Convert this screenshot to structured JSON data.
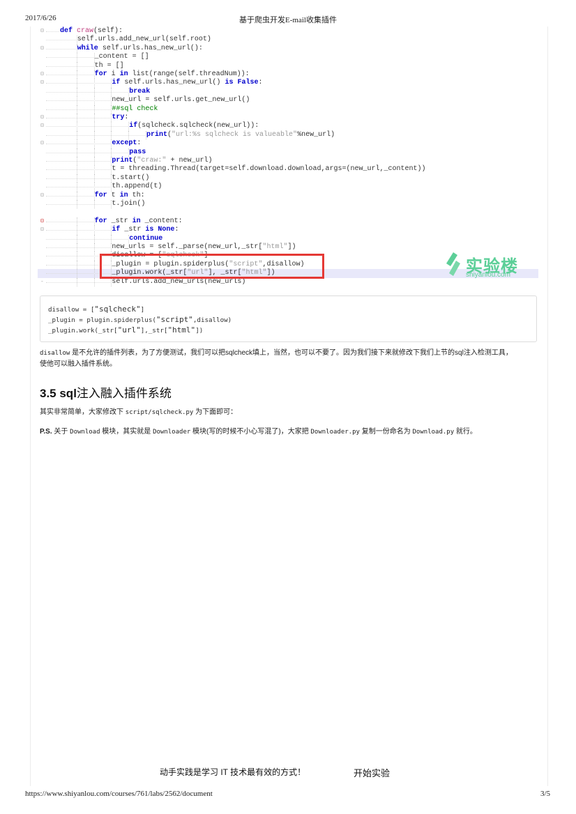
{
  "print_header": {
    "date": "2017/6/26",
    "title": "基于爬虫开发E-mail收集插件"
  },
  "code_screenshot": {
    "lines": [
      {
        "indent": 1,
        "gutter": "fold",
        "parts": [
          [
            "kw",
            "def "
          ],
          [
            "fn",
            "craw"
          ],
          [
            "",
            "(self):"
          ]
        ]
      },
      {
        "indent": 2,
        "gutter": "",
        "parts": [
          [
            "",
            "self.urls.add_new_url(self.root)"
          ]
        ]
      },
      {
        "indent": 2,
        "gutter": "fold",
        "parts": [
          [
            "kw",
            "while "
          ],
          [
            "",
            "self.urls.has_new_url():"
          ]
        ]
      },
      {
        "indent": 3,
        "gutter": "",
        "parts": [
          [
            "",
            "_content = []"
          ]
        ]
      },
      {
        "indent": 3,
        "gutter": "",
        "parts": [
          [
            "",
            "th = []"
          ]
        ]
      },
      {
        "indent": 3,
        "gutter": "fold",
        "parts": [
          [
            "kw",
            "for "
          ],
          [
            "",
            "i "
          ],
          [
            "kw",
            "in "
          ],
          [
            "",
            "list(range(self.threadNum)):"
          ]
        ]
      },
      {
        "indent": 4,
        "gutter": "fold",
        "parts": [
          [
            "kw",
            "if "
          ],
          [
            "",
            "self.urls.has_new_url() "
          ],
          [
            "kw",
            "is False"
          ],
          [
            "",
            ":"
          ]
        ]
      },
      {
        "indent": 5,
        "gutter": "",
        "parts": [
          [
            "kw",
            "break"
          ]
        ]
      },
      {
        "indent": 4,
        "gutter": "",
        "parts": [
          [
            "",
            "new_url = self.urls.get_new_url()"
          ]
        ]
      },
      {
        "indent": 4,
        "gutter": "",
        "parts": [
          [
            "cm",
            "##sql check"
          ]
        ]
      },
      {
        "indent": 4,
        "gutter": "fold",
        "parts": [
          [
            "kw",
            "try"
          ],
          [
            "",
            ":"
          ]
        ]
      },
      {
        "indent": 5,
        "gutter": "fold",
        "parts": [
          [
            "kw",
            "if"
          ],
          [
            "",
            "(sqlcheck.sqlcheck(new_url)):"
          ]
        ]
      },
      {
        "indent": 6,
        "gutter": "",
        "parts": [
          [
            "kw",
            "print"
          ],
          [
            "",
            "("
          ],
          [
            "str",
            "\"url:%s sqlcheck is valueable\""
          ],
          [
            "",
            "%new_url)"
          ]
        ]
      },
      {
        "indent": 4,
        "gutter": "fold",
        "parts": [
          [
            "kw",
            "except"
          ],
          [
            "",
            ":"
          ]
        ]
      },
      {
        "indent": 5,
        "gutter": "",
        "parts": [
          [
            "kw",
            "pass"
          ]
        ]
      },
      {
        "indent": 4,
        "gutter": "",
        "parts": [
          [
            "kw",
            "print"
          ],
          [
            "",
            "("
          ],
          [
            "str",
            "\"craw:\""
          ],
          [
            "",
            " + new_url)"
          ]
        ]
      },
      {
        "indent": 4,
        "gutter": "",
        "parts": [
          [
            "",
            "t = threading.Thread(target=self.download.download,args=(new_url,_content))"
          ]
        ]
      },
      {
        "indent": 4,
        "gutter": "",
        "parts": [
          [
            "",
            "t.start()"
          ]
        ]
      },
      {
        "indent": 4,
        "gutter": "",
        "parts": [
          [
            "",
            "th.append(t)"
          ]
        ]
      },
      {
        "indent": 3,
        "gutter": "fold",
        "parts": [
          [
            "kw",
            "for "
          ],
          [
            "",
            "t "
          ],
          [
            "kw",
            "in "
          ],
          [
            "",
            "th:"
          ]
        ]
      },
      {
        "indent": 4,
        "gutter": "",
        "parts": [
          [
            "",
            "t.join()"
          ]
        ]
      },
      {
        "indent": 0,
        "gutter": "",
        "parts": []
      },
      {
        "indent": 3,
        "gutter": "fold-red",
        "parts": [
          [
            "kw",
            "for "
          ],
          [
            "",
            "_str "
          ],
          [
            "kw",
            "in "
          ],
          [
            "",
            "_content:"
          ]
        ]
      },
      {
        "indent": 4,
        "gutter": "fold",
        "parts": [
          [
            "kw",
            "if "
          ],
          [
            "",
            "_str "
          ],
          [
            "kw",
            "is None"
          ],
          [
            "",
            ":"
          ]
        ]
      },
      {
        "indent": 5,
        "gutter": "",
        "parts": [
          [
            "kw",
            "continue"
          ]
        ]
      },
      {
        "indent": 4,
        "gutter": "",
        "parts": [
          [
            "",
            "new_urls = self._parse(new_url,_str["
          ],
          [
            "str",
            "\"html\""
          ],
          [
            "",
            "])"
          ]
        ]
      },
      {
        "indent": 4,
        "gutter": "",
        "parts": [
          [
            "",
            "disallow = ["
          ],
          [
            "str",
            "\"sqlcheck\""
          ],
          [
            "",
            "]"
          ]
        ]
      },
      {
        "indent": 4,
        "gutter": "",
        "parts": [
          [
            "",
            "_plugin = plugin.spiderplus("
          ],
          [
            "str",
            "\"script\""
          ],
          [
            "",
            ",disallow)"
          ]
        ]
      },
      {
        "indent": 4,
        "gutter": "",
        "highlight": true,
        "parts": [
          [
            "",
            "_plugin.work(_str["
          ],
          [
            "str",
            "\"url\""
          ],
          [
            "",
            "], _str["
          ],
          [
            "str",
            "\"html\""
          ],
          [
            "",
            "])"
          ]
        ]
      },
      {
        "indent": 4,
        "gutter": "tick",
        "parts": [
          [
            "",
            "self.urls.add_new_urls(new_urls)"
          ]
        ]
      }
    ],
    "watermark": {
      "name": "实验楼",
      "domain": "shiyanlou.com",
      "color": "#5ccf98"
    },
    "highlight_box_color": "#e53935"
  },
  "code_block": {
    "line1_a": "disallow = [",
    "line1_b": "\"sqlcheck\"",
    "line1_c": "]",
    "line2_a": "_plugin = plugin.spiderplus(",
    "line2_b": "\"script\"",
    "line2_c": ",disallow)",
    "line3_a": "_plugin.work(_str[",
    "line3_b": "\"url\"",
    "line3_c": "],_str[",
    "line3_d": "\"html\"",
    "line3_e": "])"
  },
  "paragraph1": {
    "code": "disallow",
    "text1": " 是不允许的插件列表，为了方便测试，我们可以把sqlcheck填上，当然，也可以不要了。因为我们接下来就修改下我们上节的sql注入检测工具，",
    "text2": "使他可以融入插件系统。"
  },
  "section": {
    "number": "3.5 sql",
    "title": "注入融入插件系统"
  },
  "paragraph2": {
    "text1": "其实非常简单，大家修改下 ",
    "code": "script/sqlcheck.py",
    "text2": " 为下面即可："
  },
  "paragraph3": {
    "prefix": "P.S. ",
    "t1": "关于 ",
    "c1": "Download",
    "t2": " 模块，其实就是 ",
    "c2": "Downloader",
    "t3": " 模块(写的时候不小心写混了)，大家把 ",
    "c3": "Downloader.py",
    "t4": " 复制一份命名为 ",
    "c4": "Download.py",
    "t5": " 就行。"
  },
  "footer_cta": {
    "slogan": "动手实践是学习 IT 技术最有效的方式！",
    "button": "开始实验"
  },
  "print_footer": {
    "url": "https://www.shiyanlou.com/courses/761/labs/2562/document",
    "page": "3/5"
  }
}
